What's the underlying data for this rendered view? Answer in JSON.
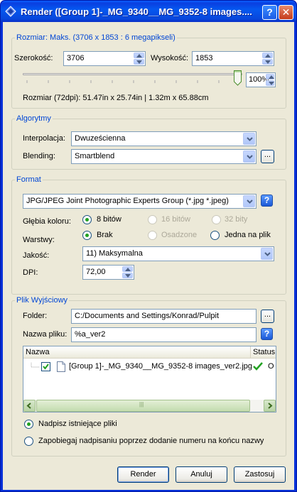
{
  "window": {
    "title": "Render ([Group 1]-_MG_9340__MG_9352-8 images....",
    "help_glyph": "?",
    "close_glyph": "✕"
  },
  "size_group": {
    "legend": "Rozmiar: Maks. (3706 x 1853 : 6 megapikseli)",
    "width_label": "Szerokość:",
    "width_value": "3706",
    "height_label": "Wysokość:",
    "height_value": "1853",
    "zoom_value": "100%",
    "slider_level_percent": 100,
    "info": "Rozmiar (72dpi): 51.47in x 25.74in |  1.32m x 65.88cm"
  },
  "algorithms_group": {
    "legend": "Algorytmy",
    "interpolation_label": "Interpolacja:",
    "interpolation_value": "Dwuześcienna",
    "blending_label": "Blending:",
    "blending_value": "Smartblend",
    "ellipsis": "..."
  },
  "format_group": {
    "legend": "Format",
    "format_value": "JPG/JPEG Joint Photographic Experts Group (*.jpg *.jpeg)",
    "depth_label": "Głębia koloru:",
    "depth_options": [
      "8 bitów",
      "16 bitów",
      "32 bity"
    ],
    "layers_label": "Warstwy:",
    "layers_options": [
      "Brak",
      "Osadzone",
      "Jedna na plik"
    ],
    "quality_label": "Jakość:",
    "quality_value": "11) Maksymalna",
    "dpi_label": "DPI:",
    "dpi_value": "72,00",
    "help_glyph": "?"
  },
  "output_group": {
    "legend": "Plik Wyjściowy",
    "folder_label": "Folder:",
    "folder_value": "C:/Documents and Settings/Konrad/Pulpit",
    "filename_label": "Nazwa pliku:",
    "filename_value": "%a_ver2",
    "ellipsis": "...",
    "help_glyph": "?",
    "list_headers": [
      "Nazwa",
      "Status"
    ],
    "list_rows": [
      {
        "name": "[Group 1]-_MG_9340__MG_9352-8 images_ver2.jpg",
        "status": "O"
      }
    ],
    "scroll_grip": "|||",
    "options": [
      "Nadpisz istniejące pliki",
      "Zapobiegaj nadpisaniu poprzez dodanie numeru na końcu nazwy"
    ]
  },
  "buttons": {
    "render": "Render",
    "cancel": "Anuluj",
    "apply": "Zastosuj"
  },
  "colors": {
    "title_bar": "#0a5fff",
    "legend_text": "#0046d5",
    "dialog_bg": "#ece9d8",
    "radio_dot": "#21a121"
  }
}
